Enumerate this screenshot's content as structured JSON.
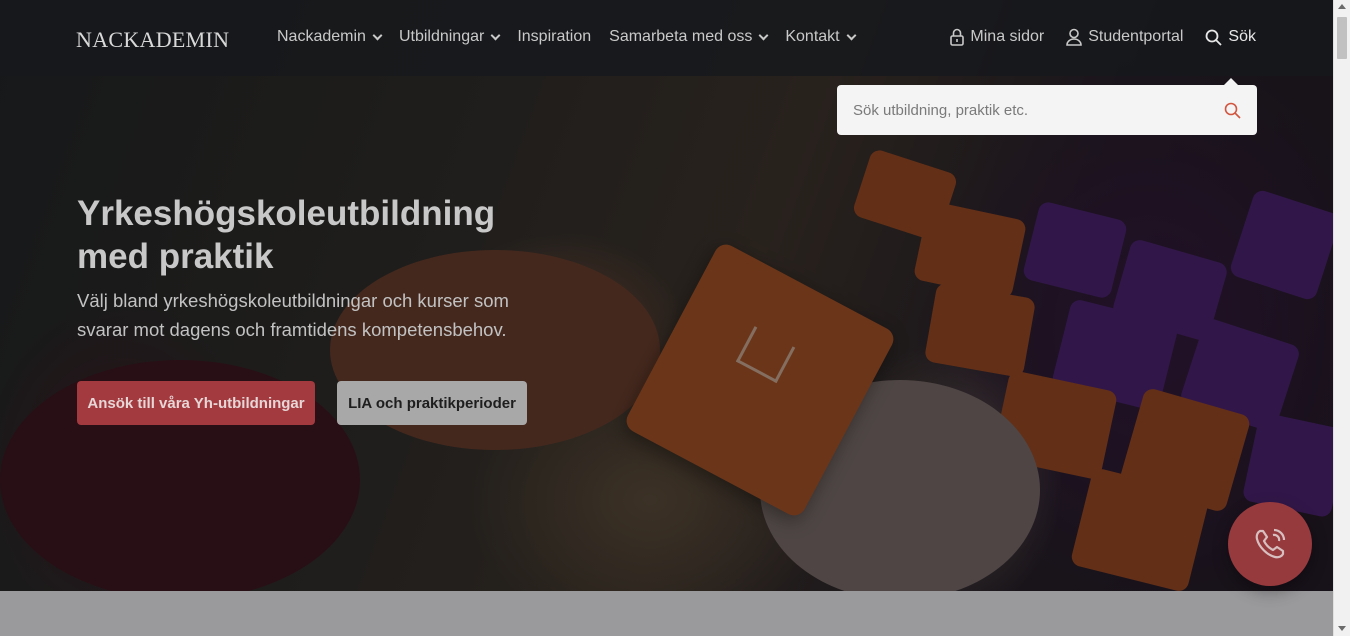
{
  "nav": {
    "logo": "NACKADEMIN",
    "menu": [
      {
        "label": "Nackademin",
        "dropdown": true
      },
      {
        "label": "Utbildningar",
        "dropdown": true
      },
      {
        "label": "Inspiration",
        "dropdown": false
      },
      {
        "label": "Samarbeta med oss",
        "dropdown": true
      },
      {
        "label": "Kontakt",
        "dropdown": true
      }
    ],
    "mina_sidor": "Mina sidor",
    "studentportal": "Studentportal",
    "sok": "Sök"
  },
  "search": {
    "placeholder": "Sök utbildning, praktik etc."
  },
  "hero": {
    "title_line1": "Yrkeshögskoleutbildning",
    "title_line2": "med praktik",
    "lead_line1": "Välj bland yrkeshögskoleutbildningar och kurser som",
    "lead_line2": "svarar mot dagens och framtidens kompetensbehov.",
    "primary_button": "Ansök till våra Yh-utbildningar",
    "secondary_button": "LIA och praktikperioder"
  },
  "colors": {
    "accent": "#a23a3f",
    "search_icon": "#d2553f"
  },
  "icons": {
    "lock": "lock-icon",
    "user": "user-icon",
    "search": "search-icon",
    "phone": "phone-icon"
  }
}
